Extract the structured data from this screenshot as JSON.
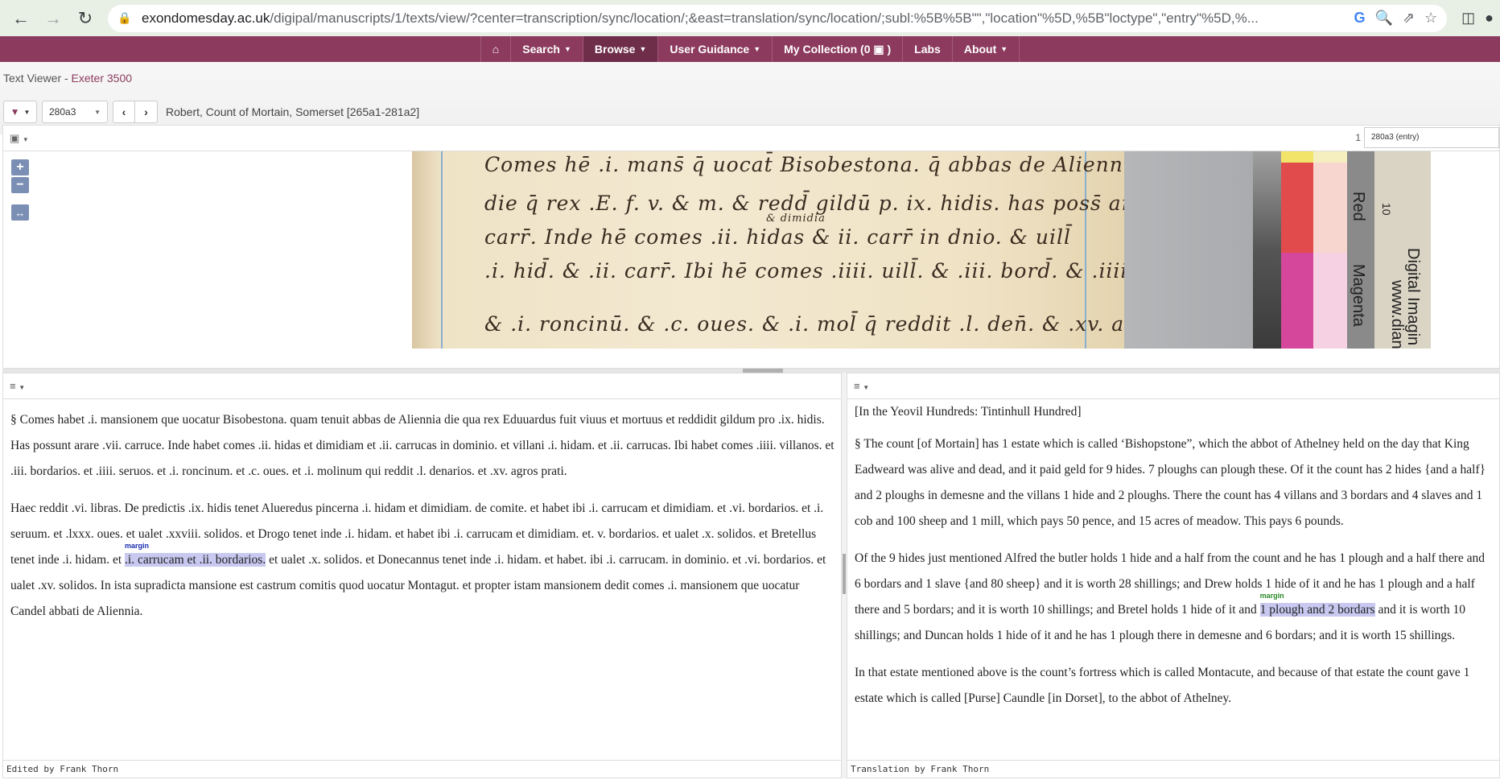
{
  "browser": {
    "url_host": "exondomesday.ac.uk",
    "url_path": "/digipal/manuscripts/1/texts/view/?center=transcription/sync/location/;&east=translation/sync/location/;subl:%5B%5B\"\",\"location\"%5D,%5B\"loctype\",\"entry\"%5D,%..."
  },
  "navbar": {
    "items": [
      {
        "label": "",
        "icon": "home-icon"
      },
      {
        "label": "Search",
        "dropdown": true
      },
      {
        "label": "Browse",
        "dropdown": true,
        "active": true
      },
      {
        "label": "User Guidance",
        "dropdown": true
      },
      {
        "label": "My Collection (0 ▣ )",
        "dropdown": false
      },
      {
        "label": "Labs",
        "dropdown": false
      },
      {
        "label": "About",
        "dropdown": true
      }
    ]
  },
  "breadcrumb": {
    "prefix": "Text Viewer - ",
    "link": "Exeter 3500"
  },
  "toolbar": {
    "filter_icon": "▼",
    "page_value": "280a3",
    "prev": "‹",
    "next": "›",
    "location": "Robert, Count of Mortain, Somerset [265a1-281a2]"
  },
  "image_panel": {
    "menu_icon": "image-icon",
    "page_number": "1",
    "entry_value": "280a3 (entry)",
    "zoom_in": "+",
    "zoom_out": "−",
    "fit": "↔",
    "manuscript_lines": [
      "Comes hē .i. mans̄ q̄ uocat̄ Bisobestona. q̄ abbas de Aliennia",
      "die q̄ rex .E. f. v. & m. & redd̄ gildū p. ix. hidis. has poss̄ arare. vii.",
      "carr̄. Inde hē comes .ii. hidas & ii. carr̄ in dnio. & uill̄",
      ".i. hid̄. & .ii. carr̄. Ibi hē comes .iiii. uill̄. & .iii. bord̄. & .iiii. seruos.",
      "& .i. roncinū. & .c. oues. & .i. mol̄ q̄ reddit .l. den̄. & .xv. aḡ p̄ti."
    ],
    "interlinear": "& dimidia",
    "color_card": [
      "Red",
      "10",
      "Magenta",
      "Digital Imagin",
      "www.dian"
    ]
  },
  "transcription": {
    "paragraphs": [
      {
        "text": "§ Comes habet .i. mansionem que uocatur Bisobestona. quam tenuit abbas de Aliennia die qua rex Eduuardus fuit viuus et mortuus et reddidit gildum pro .ix. hidis. Has possunt arare .vii. carruce. Inde habet comes .ii. hidas et dimidiam et .ii. carrucas in dominio. et villani .i. hidam. et .ii. carrucas. Ibi habet comes .iiii. villanos. et .iii. bordarios. et .iiii. seruos. et .i. roncinum. et .c. oues. et .i. molinum qui reddit .l. denarios. et .xv. agros prati."
      },
      {
        "before": "Haec reddit .vi. libras. De predictis .ix. hidis tenet Alueredus pincerna .i. hidam et dimidiam. de comite. et habet ibi .i. carrucam et dimidiam. et .vi. bordarios. et .i. seruum. et .lxxx. oues. et ualet .xxviii. solidos. et Drogo tenet inde .i. hidam. et habet ibi .i. carrucam et dimidiam. et. v. bordarios. et ualet .x. solidos. et Bretellus tenet inde .i. hidam. et ",
        "highlight": ".i. carrucam et .ii. bordarios.",
        "margin_label": "margin",
        "after": " et ualet .x. solidos. et Donecannus tenet inde .i. hidam. et habet. ibi .i. carrucam. in dominio. et .vi. bordarios. et ualet .xv. solidos. In ista supradicta mansione est castrum comitis quod uocatur Montagut. et propter istam mansionem dedit comes .i. mansionem que uocatur Candel abbati de Aliennia."
      }
    ],
    "footer": "Edited by Frank Thorn"
  },
  "translation": {
    "paragraphs": [
      {
        "text": "[In the Yeovil Hundreds: Tintinhull Hundred]"
      },
      {
        "text": "§ The count [of Mortain] has 1 estate which is called ‘Bishopstone”, which the abbot of Athelney held on the day that King Eadweard was alive and dead, and it paid geld for 9 hides. 7 ploughs can plough these. Of it the count has 2 hides {and a half} and 2 ploughs in demesne and the villans 1 hide and 2 ploughs. There the count has 4 villans and 3 bordars and 4 slaves and 1 cob and 100 sheep and 1 mill, which pays 50 pence, and 15 acres of meadow. This pays 6 pounds."
      },
      {
        "before": "Of the 9 hides just mentioned Alfred the butler holds 1 hide and a half from the count and he has 1 plough and a half there and 6 bordars and 1 slave {and 80 sheep} and it is worth 28 shillings; and Drew holds 1 hide of it and he has 1 plough and a half there and 5 bordars; and it is worth 10 shillings; and Bretel holds 1 hide of it and ",
        "highlight": "1 plough and 2 bordars",
        "margin_label": "margin",
        "after": " and it is worth 10 shillings; and Duncan holds 1 hide of it and he has 1 plough there in demesne and 6 bordars; and it is worth 15 shillings."
      },
      {
        "text": "In that estate mentioned above is the count’s fortress which is called Montacute, and because of that estate the count gave 1 estate which is called [Purse] Caundle [in Dorset], to the abbot of Athelney."
      }
    ],
    "footer": "Translation by Frank Thorn"
  },
  "colors": {
    "brand": "#8c3b5e",
    "highlight": "#c8c8f0",
    "margin_blue": "#1a2eb0",
    "margin_green": "#2a8a2a"
  }
}
